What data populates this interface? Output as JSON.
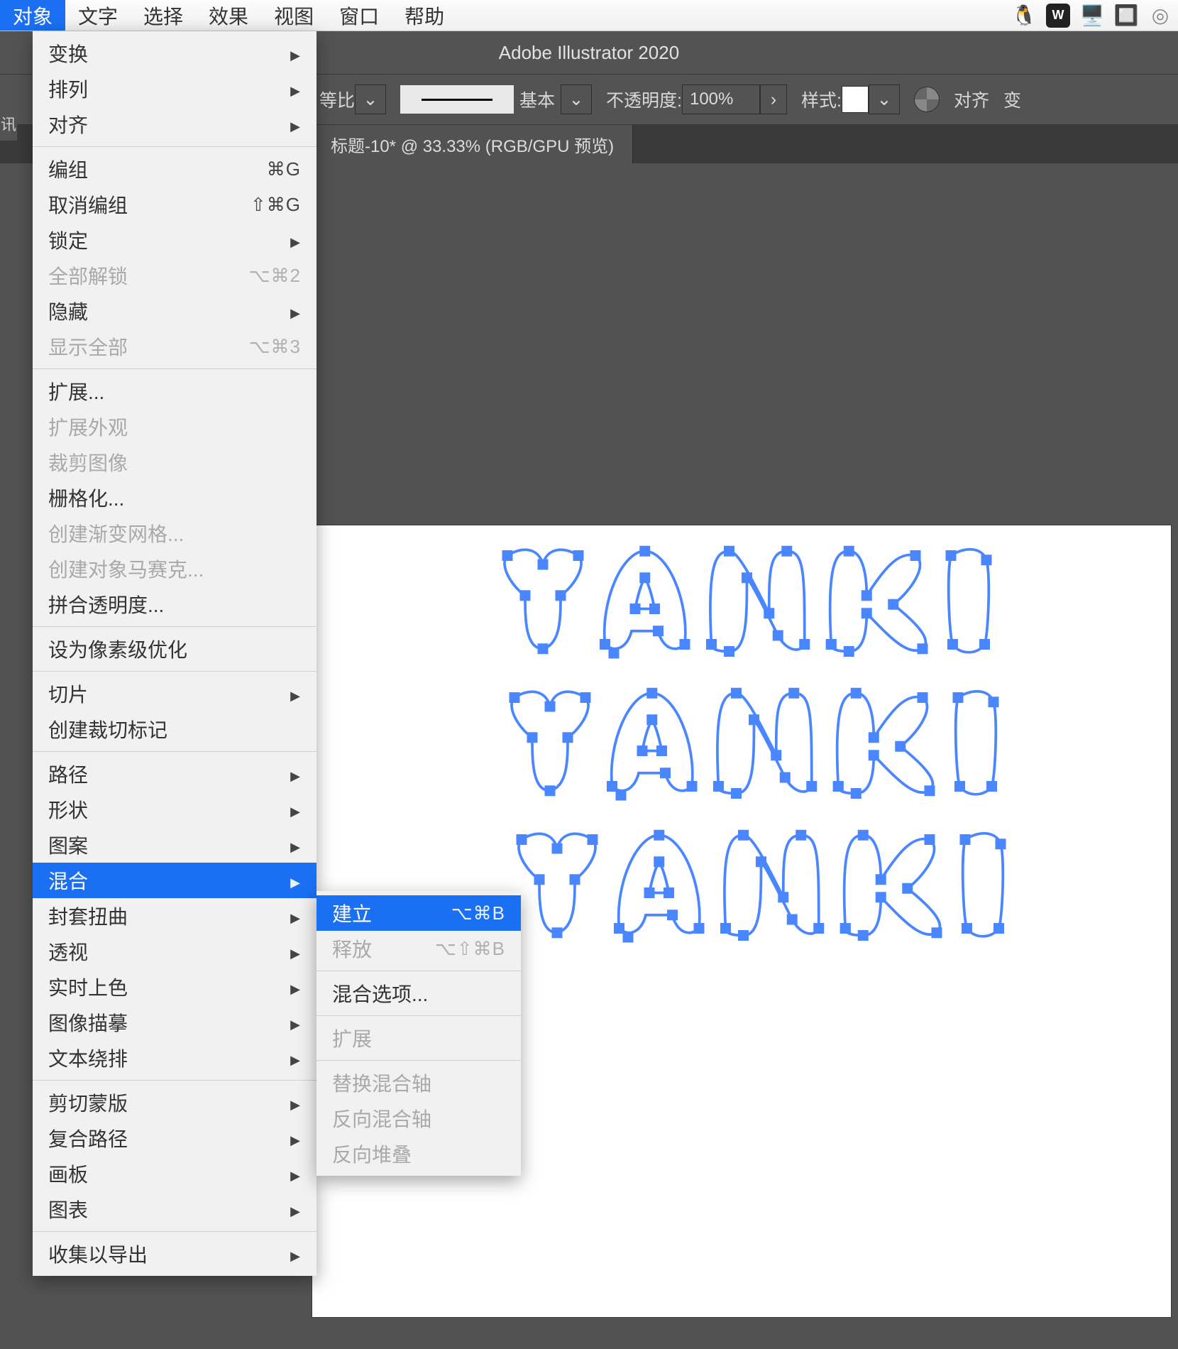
{
  "menubar": {
    "items": [
      "对象",
      "文字",
      "选择",
      "效果",
      "视图",
      "窗口",
      "帮助"
    ],
    "active_index": 0,
    "right_icons": [
      "penguin-icon",
      "wps-icon",
      "display-icon",
      "battery-icon",
      "cc-icon"
    ]
  },
  "titlebar": {
    "app_title": "Adobe Illustrator 2020"
  },
  "optionsbar": {
    "ratio_label": "等比",
    "stroke_style_label": "基本",
    "opacity_label": "不透明度:",
    "opacity_value": "100%",
    "style_label": "样式:",
    "align_label": "对齐",
    "trailing_label": "变"
  },
  "tab": {
    "title": "标题-10* @ 33.33% (RGB/GPU 预览)"
  },
  "artwork": {
    "text1": "YANKI",
    "text2": "YANKI",
    "text3": "YANKI"
  },
  "left_edge_hint": "讯",
  "object_menu": {
    "groups": [
      [
        {
          "label": "变换",
          "arrow": true
        },
        {
          "label": "排列",
          "arrow": true
        },
        {
          "label": "对齐",
          "arrow": true
        }
      ],
      [
        {
          "label": "编组",
          "shortcut": "⌘G"
        },
        {
          "label": "取消编组",
          "shortcut": "⇧⌘G"
        },
        {
          "label": "锁定",
          "arrow": true
        },
        {
          "label": "全部解锁",
          "shortcut": "⌥⌘2",
          "disabled": true
        },
        {
          "label": "隐藏",
          "arrow": true
        },
        {
          "label": "显示全部",
          "shortcut": "⌥⌘3",
          "disabled": true
        }
      ],
      [
        {
          "label": "扩展..."
        },
        {
          "label": "扩展外观",
          "disabled": true
        },
        {
          "label": "裁剪图像",
          "disabled": true
        },
        {
          "label": "栅格化..."
        },
        {
          "label": "创建渐变网格...",
          "disabled": true
        },
        {
          "label": "创建对象马赛克...",
          "disabled": true
        },
        {
          "label": "拼合透明度..."
        }
      ],
      [
        {
          "label": "设为像素级优化"
        }
      ],
      [
        {
          "label": "切片",
          "arrow": true
        },
        {
          "label": "创建裁切标记"
        }
      ],
      [
        {
          "label": "路径",
          "arrow": true
        },
        {
          "label": "形状",
          "arrow": true
        },
        {
          "label": "图案",
          "arrow": true
        },
        {
          "label": "混合",
          "arrow": true,
          "highlight": true
        },
        {
          "label": "封套扭曲",
          "arrow": true
        },
        {
          "label": "透视",
          "arrow": true
        },
        {
          "label": "实时上色",
          "arrow": true
        },
        {
          "label": "图像描摹",
          "arrow": true
        },
        {
          "label": "文本绕排",
          "arrow": true
        }
      ],
      [
        {
          "label": "剪切蒙版",
          "arrow": true
        },
        {
          "label": "复合路径",
          "arrow": true
        },
        {
          "label": "画板",
          "arrow": true
        },
        {
          "label": "图表",
          "arrow": true
        }
      ],
      [
        {
          "label": "收集以导出",
          "arrow": true
        }
      ]
    ]
  },
  "blend_submenu": {
    "groups": [
      [
        {
          "label": "建立",
          "shortcut": "⌥⌘B",
          "highlight": true
        },
        {
          "label": "释放",
          "shortcut": "⌥⇧⌘B",
          "disabled": true
        }
      ],
      [
        {
          "label": "混合选项..."
        }
      ],
      [
        {
          "label": "扩展",
          "disabled": true
        }
      ],
      [
        {
          "label": "替换混合轴",
          "disabled": true
        },
        {
          "label": "反向混合轴",
          "disabled": true
        },
        {
          "label": "反向堆叠",
          "disabled": true
        }
      ]
    ]
  }
}
